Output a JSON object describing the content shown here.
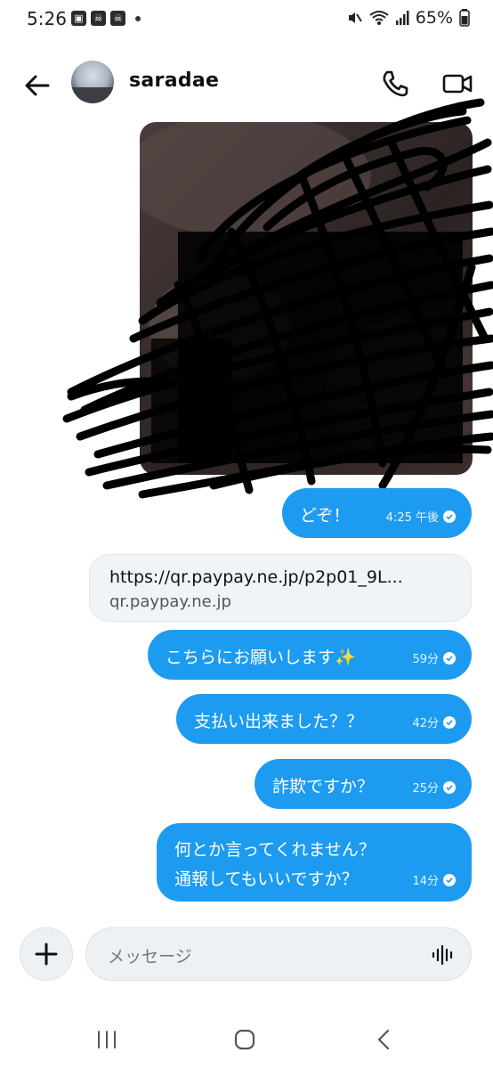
{
  "status_bar": {
    "time": "5:26",
    "battery": "65%",
    "left_icons": [
      "gallery-icon",
      "skull-icon",
      "skull-icon",
      "dot"
    ],
    "right_icons": [
      "mute-icon",
      "wifi-icon",
      "signal-icon",
      "battery-icon"
    ]
  },
  "header": {
    "username": "saradae",
    "icons": [
      "back-arrow-icon",
      "phone-icon",
      "video-icon"
    ]
  },
  "messages": [
    {
      "type": "image",
      "content": "photo (redacted with scribbles)"
    },
    {
      "type": "sent",
      "text": "どぞ！",
      "time": "4:25 午後"
    },
    {
      "type": "received-link",
      "url": "https://qr.paypay.ne.jp/p2p01_9L...",
      "domain": "qr.paypay.ne.jp"
    },
    {
      "type": "sent",
      "text": "こちらにお願いします✨",
      "time": "59分"
    },
    {
      "type": "sent",
      "text": "支払い出来ました？？",
      "time": "42分"
    },
    {
      "type": "sent",
      "text": "詐欺ですか？",
      "time": "25分"
    },
    {
      "type": "sent",
      "line1": "何とか言ってくれません？",
      "line2": "通報してもいいですか？",
      "time": "14分"
    }
  ],
  "composer": {
    "placeholder": "メッセージ"
  },
  "colors": {
    "bubble": "#1d9bf0",
    "received": "#f1f4f6",
    "background": "#ffffff"
  }
}
